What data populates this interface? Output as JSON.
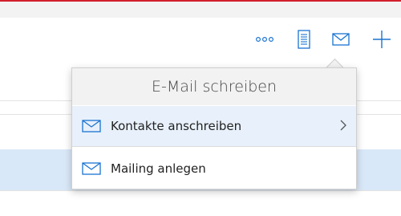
{
  "colors": {
    "accent": "#1a73d1",
    "brand_red": "#d4202c",
    "selection": "#d9e8f8",
    "menu_highlight": "#e8f1fb"
  },
  "toolbar": {
    "icons": [
      "more-icon",
      "note-icon",
      "mail-icon",
      "add-icon"
    ]
  },
  "popover": {
    "title": "E-Mail schreiben",
    "items": [
      {
        "label": "Kontakte anschreiben",
        "icon": "mail-icon",
        "has_submenu": true
      },
      {
        "label": "Mailing anlegen",
        "icon": "mail-icon",
        "has_submenu": false
      }
    ]
  }
}
